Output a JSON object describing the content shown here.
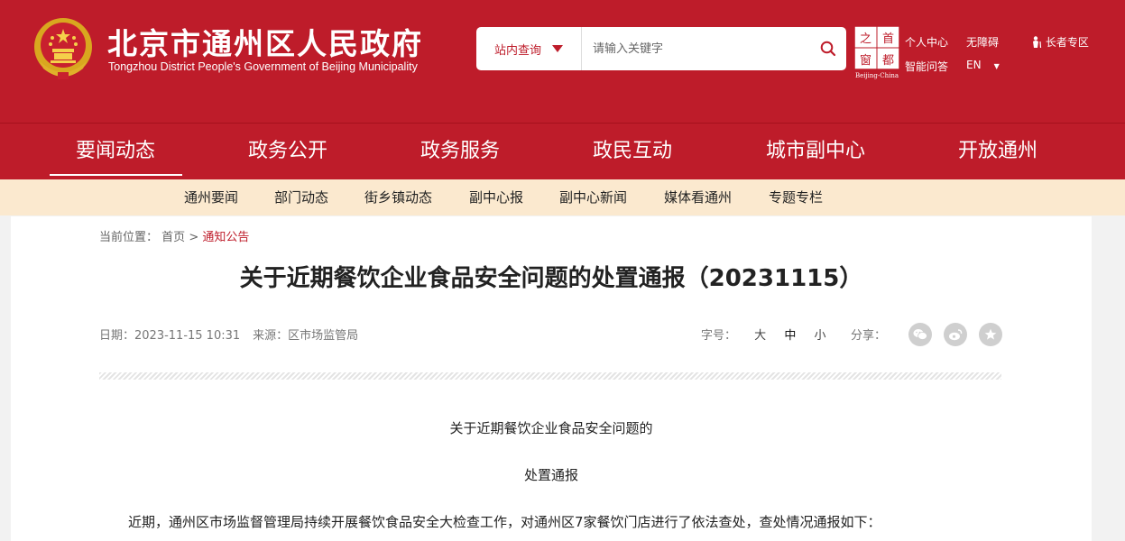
{
  "header": {
    "title_cn": "北京市通州区人民政府",
    "title_en": "Tongzhou District People's Government of Beijing Municipality",
    "search": {
      "scope_label": "站内查询",
      "placeholder": "请输入关键字"
    },
    "capital_logo": {
      "chars": [
        "之",
        "首",
        "窗",
        "都"
      ],
      "caption": "Beijing-China"
    },
    "links": {
      "personal_center": "个人中心",
      "smart_qa": "智能问答",
      "accessibility": "无障碍",
      "english": "EN",
      "elderly": "长者专区"
    }
  },
  "main_nav": {
    "items": [
      "要闻动态",
      "政务公开",
      "政务服务",
      "政民互动",
      "城市副中心",
      "开放通州"
    ],
    "active_index": 0
  },
  "sub_nav": {
    "items": [
      "通州要闻",
      "部门动态",
      "街乡镇动态",
      "副中心报",
      "副中心新闻",
      "媒体看通州",
      "专题专栏"
    ]
  },
  "breadcrumb": {
    "prefix": "当前位置：",
    "home": "首页",
    "separator": ">",
    "current": "通知公告"
  },
  "article": {
    "title": "关于近期餐饮企业食品安全问题的处置通报（20231115）",
    "date_label": "日期：2023-11-15 10:31",
    "source_label": "来源：区市场监管局",
    "font_size_label": "字号：",
    "font_sizes": [
      "大",
      "中",
      "小"
    ],
    "share_label": "分享：",
    "body_heading_1": "关于近期餐饮企业食品安全问题的",
    "body_heading_2": "处置通报",
    "body_para_1": "近期，通州区市场监督管理局持续开展餐饮食品安全大检查工作，对通州区7家餐饮门店进行了依法查处，查处情况通报如下："
  },
  "colors": {
    "brand_red": "#be1c2a",
    "sub_nav_bg": "#fbe9cf",
    "page_bg": "#f2f2f2"
  }
}
